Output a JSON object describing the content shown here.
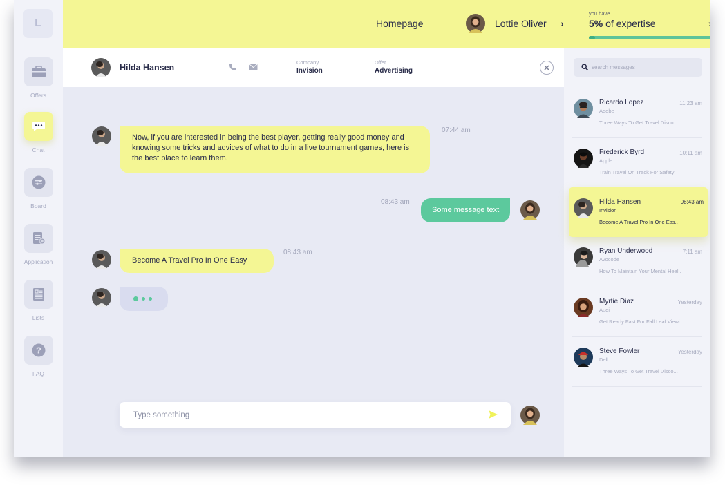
{
  "app": {
    "logo": "L"
  },
  "sidebar": {
    "items": [
      {
        "label": "Offers",
        "icon": "briefcase-icon"
      },
      {
        "label": "Chat",
        "icon": "chat-bubble-icon",
        "active": true
      },
      {
        "label": "Board",
        "icon": "sliders-icon"
      },
      {
        "label": "Application",
        "icon": "document-add-icon"
      },
      {
        "label": "Lists",
        "icon": "list-document-icon"
      },
      {
        "label": "FAQ",
        "icon": "question-icon"
      }
    ]
  },
  "topbar": {
    "homepage": "Homepage",
    "user_name": "Lottie Oliver",
    "expertise_caption": "you have",
    "expertise_value": "5%",
    "expertise_text": "of expertise",
    "expertise_progress": 0.05
  },
  "chat_header": {
    "name": "Hilda Hansen",
    "company_label": "Company",
    "company_value": "Invision",
    "offer_label": "Offer",
    "offer_value": "Advertising"
  },
  "messages": [
    {
      "direction": "in",
      "text": "Now, if you are interested in being the best player, getting really good money and knowing some tricks and advices of what to do in a live tournament games, here is the best place to learn them.",
      "time": "07:44 am"
    },
    {
      "direction": "out",
      "text": "Some message text",
      "time": "08:43 am"
    },
    {
      "direction": "in",
      "text": "Become A Travel Pro In One Easy",
      "time": "08:43 am"
    }
  ],
  "composer": {
    "placeholder": "Type something"
  },
  "search": {
    "placeholder": "search messages"
  },
  "conversations": [
    {
      "name": "Ricardo Lopez",
      "company": "Adobe",
      "time": "11:23 am",
      "preview": "Three Ways To Get Travel Disco..."
    },
    {
      "name": "Frederick Byrd",
      "company": "Apple",
      "time": "10:11 am",
      "preview": "Train Travel On Track For Safety"
    },
    {
      "name": "Hilda Hansen",
      "company": "Invision",
      "time": "08:43 am",
      "preview": "Become A Travel Pro In One Eas..",
      "active": true
    },
    {
      "name": "Ryan Underwood",
      "company": "Avocode",
      "time": "7:11 am",
      "preview": "How To Maintain Your Mental Heal.."
    },
    {
      "name": "Myrtie Diaz",
      "company": "Audi",
      "time": "Yesterday",
      "preview": "Get Ready Fast For Fall Leaf Viewi..."
    },
    {
      "name": "Steve Fowler",
      "company": "Dell",
      "time": "Yesterday",
      "preview": "Three Ways To Get Travel Disco..."
    }
  ],
  "colors": {
    "accent_yellow": "#f4f694",
    "accent_green": "#5cc99d",
    "background": "#e8eaf4",
    "text_dark": "#2a2d4a"
  }
}
